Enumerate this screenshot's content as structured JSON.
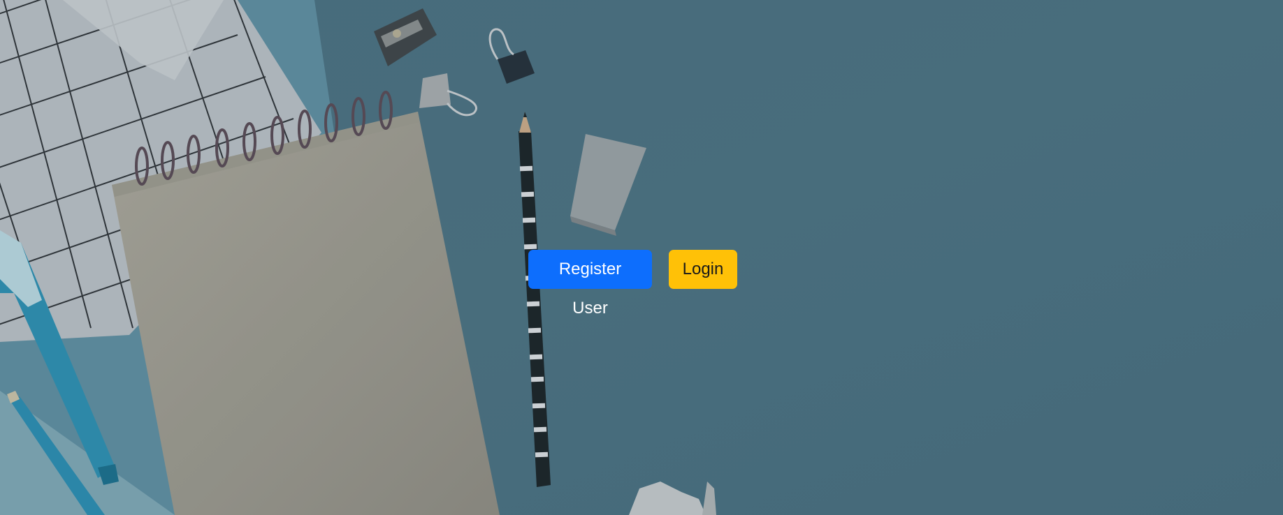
{
  "colors": {
    "background": "#4c7080",
    "register_button_bg": "#0d6efd",
    "register_button_text": "#ffffff",
    "login_button_bg": "#ffc107",
    "login_button_text": "#1a1a1a"
  },
  "background": {
    "image_description_icon": "desk-stationery-background"
  },
  "actions": {
    "register_label": "Register User",
    "login_label": "Login"
  }
}
